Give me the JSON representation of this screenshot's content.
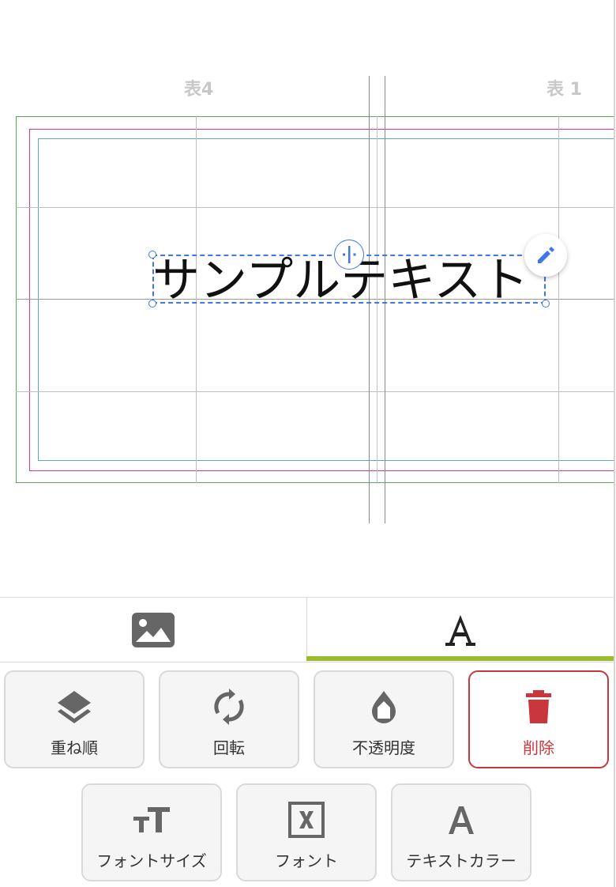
{
  "canvas": {
    "page_labels": {
      "left": "表4",
      "right": "表 1"
    },
    "sample_text": "サンプルテキスト"
  },
  "tabs": [
    {
      "name": "image-tab",
      "icon": "image-icon",
      "active": false
    },
    {
      "name": "text-tab",
      "icon": "text-a-icon",
      "active": true
    }
  ],
  "tools": {
    "layer_order": "重ね順",
    "rotate": "回転",
    "opacity": "不透明度",
    "delete": "削除",
    "font_size": "フォントサイズ",
    "font": "フォント",
    "text_color": "テキストカラー"
  },
  "colors": {
    "accent": "#3f76e8",
    "tab_underline": "#9bbb2f",
    "delete": "#c9363c",
    "icon": "#666666"
  }
}
